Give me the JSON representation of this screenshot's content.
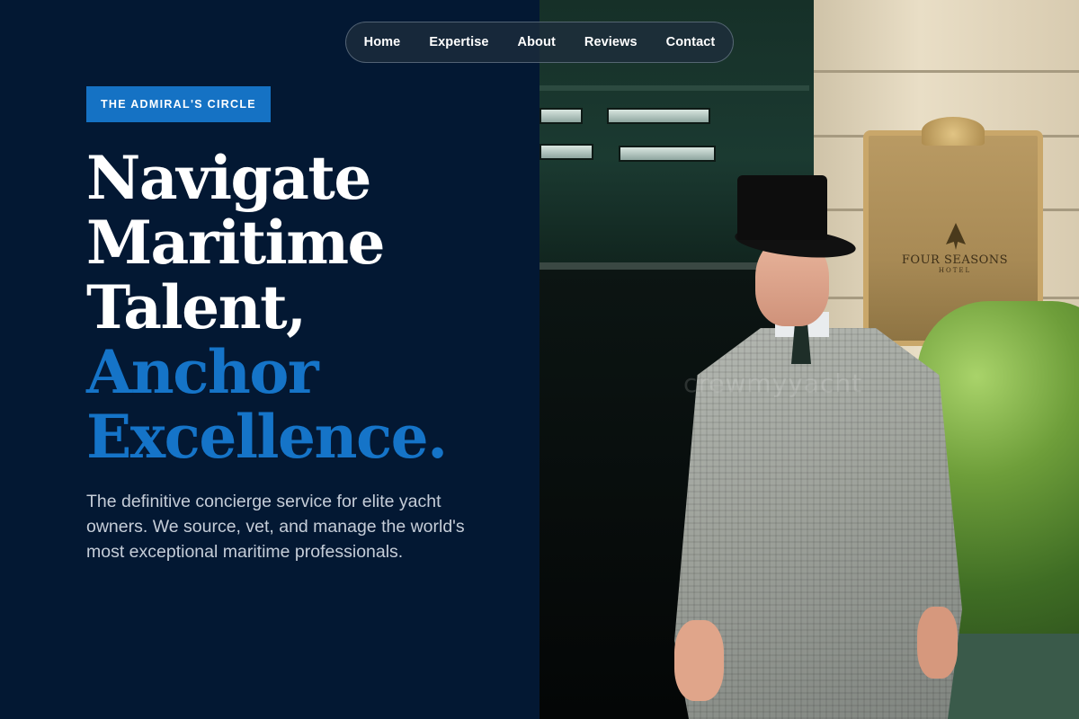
{
  "nav": {
    "items": [
      {
        "label": "Home"
      },
      {
        "label": "Expertise"
      },
      {
        "label": "About"
      },
      {
        "label": "Reviews"
      },
      {
        "label": "Contact"
      }
    ]
  },
  "hero": {
    "badge": "THE ADMIRAL'S CIRCLE",
    "headline_lines": [
      "Navigate",
      "Maritime",
      "Talent,"
    ],
    "headline_accent_lines": [
      "Anchor",
      "Excellence."
    ],
    "lead": "The definitive concierge service for elite yacht owners. We source, vet, and manage the world's most exceptional maritime professionals.",
    "accent_color": "#1574c8",
    "badge_color": "#1572c4",
    "background_color": "#031833"
  },
  "photo": {
    "plaque_text": "FOUR SEASONS",
    "plaque_subtext": "HOTEL",
    "watermark": "crewmyyacht"
  }
}
